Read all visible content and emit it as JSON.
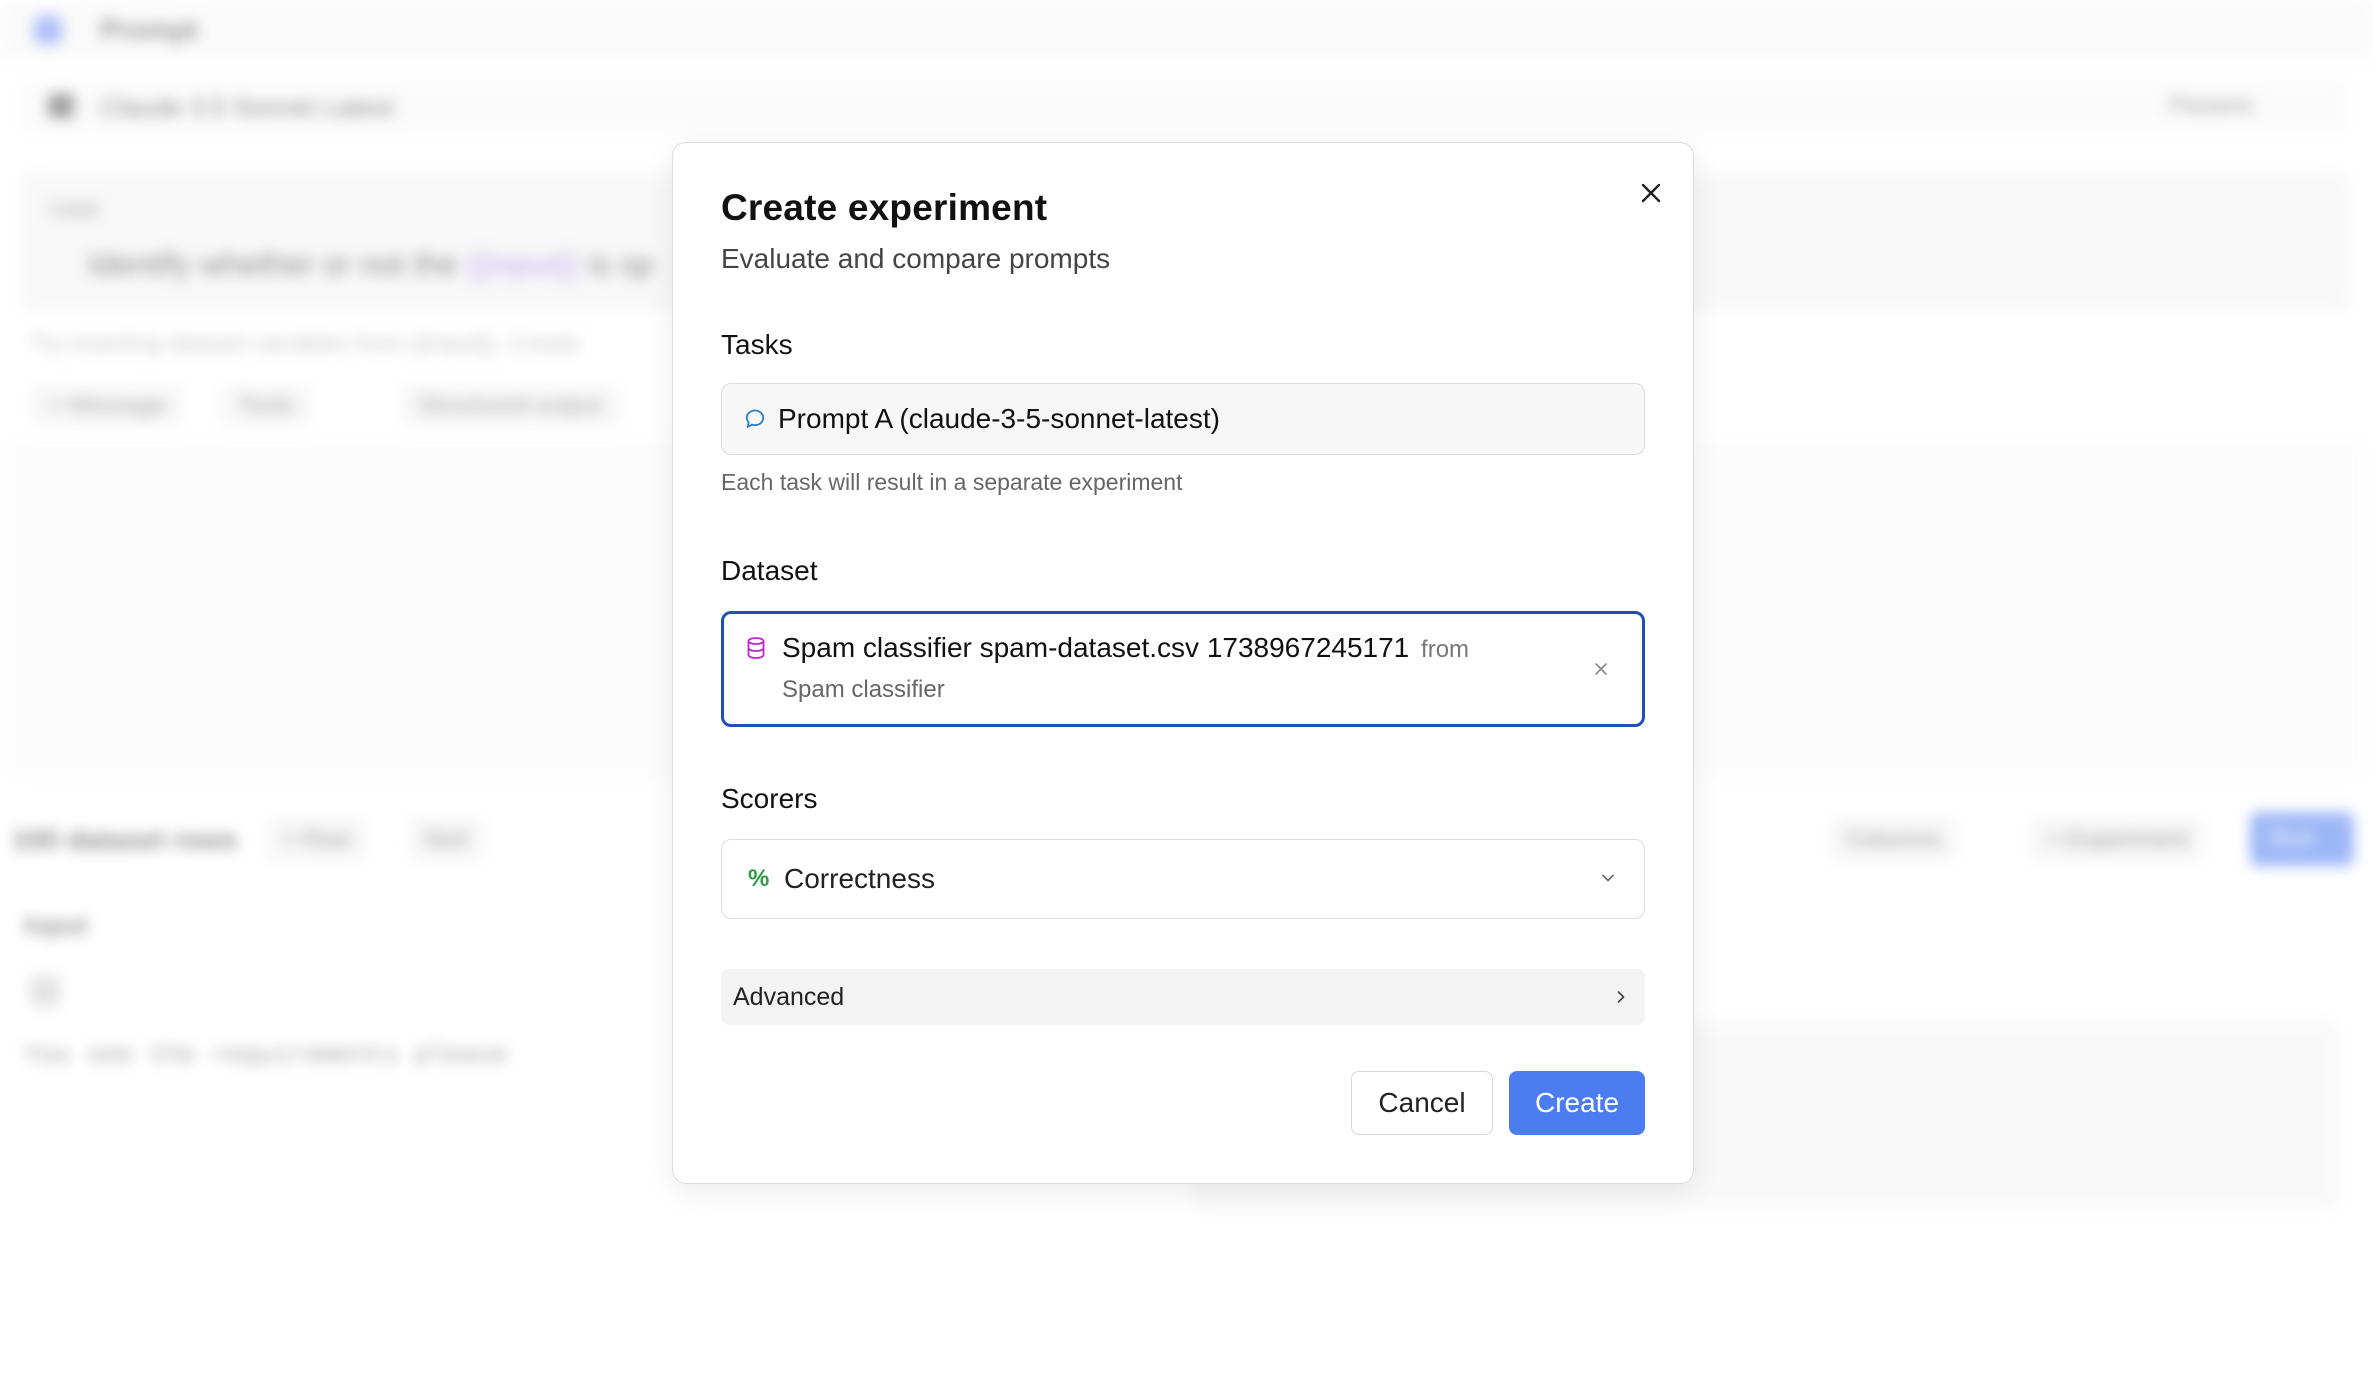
{
  "background": {
    "app_title": "Prompt",
    "model_name": "Claude 3.5 Sonnet Latest",
    "params_label": "Params",
    "message_role": "User",
    "message_text_prefix": "Identify whether or not the ",
    "message_variable": "{{input}}",
    "message_text_suffix": " is sp",
    "hint_text": "Try inserting dataset variables from {{input}}. Create",
    "chips": {
      "message": "+ Message",
      "tools": "Tools",
      "structured_output": "Structured output"
    },
    "dataset_rows_label": "100 dataset rows",
    "row_button": "+ Row",
    "sort_button": "Sort",
    "columns_button": "Columns",
    "experiment_button": "+ Experiment",
    "run_button": "Run",
    "input_header": "Input",
    "input_cell_text": "You see the requirements please"
  },
  "modal": {
    "title": "Create experiment",
    "subtitle": "Evaluate and compare prompts",
    "tasks": {
      "label": "Tasks",
      "value": "Prompt A (claude-3-5-sonnet-latest)",
      "help": "Each task will result in a separate experiment",
      "icon": "chat-bubble-icon"
    },
    "dataset": {
      "label": "Dataset",
      "name": "Spam classifier spam-dataset.csv 1738967245171",
      "from_label": "from",
      "source": "Spam classifier",
      "icon": "database-icon",
      "icon_color": "#c026d3"
    },
    "scorers": {
      "label": "Scorers",
      "value": "Correctness",
      "icon": "%",
      "icon_color": "#2f9b45"
    },
    "advanced_label": "Advanced",
    "cancel_label": "Cancel",
    "create_label": "Create",
    "accent_color": "#4c7df0",
    "focus_color": "#1f4fb8"
  }
}
